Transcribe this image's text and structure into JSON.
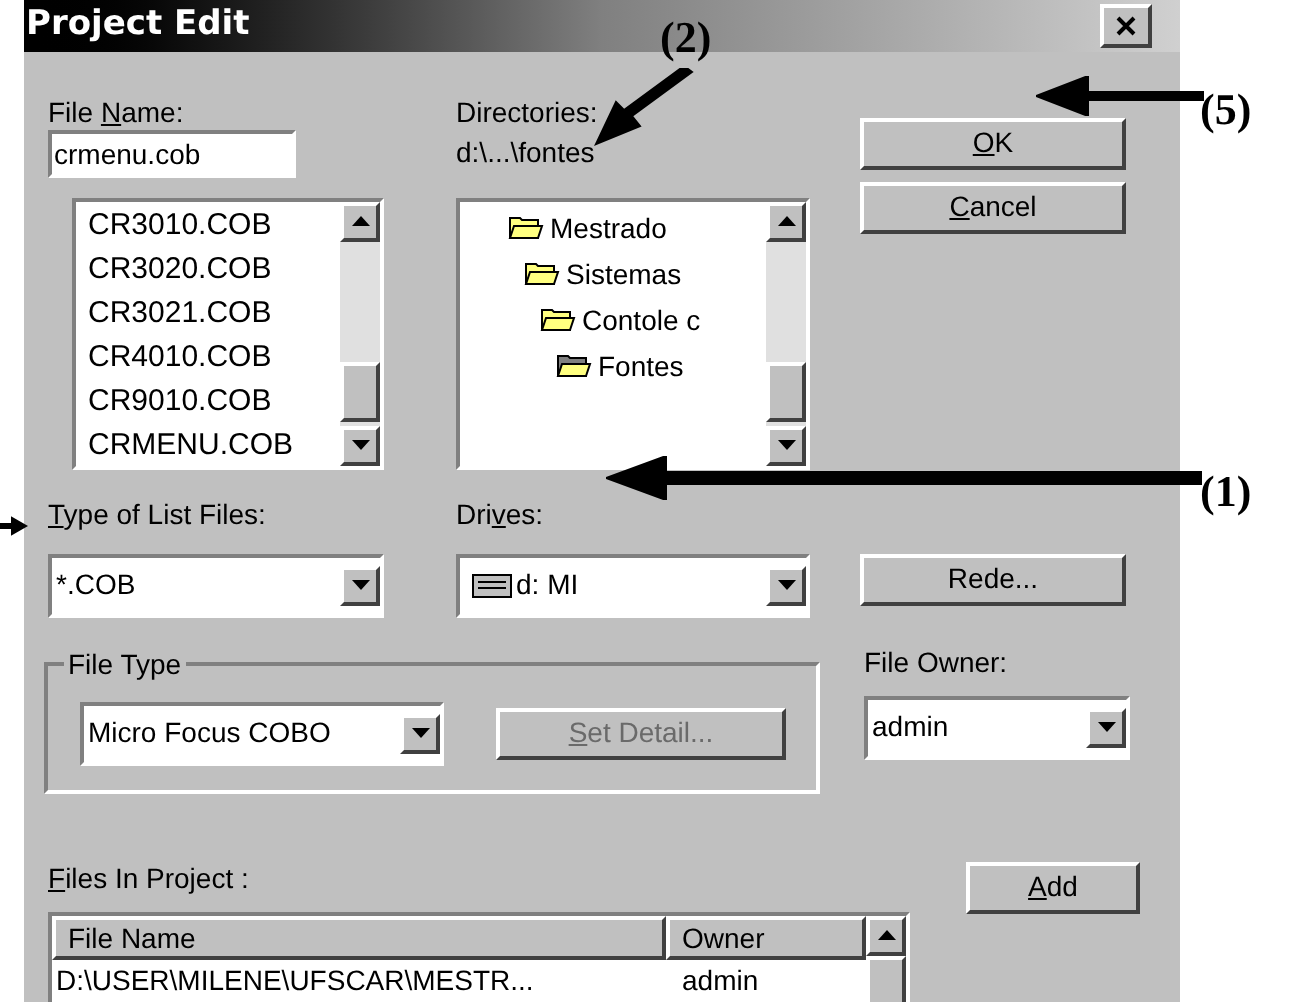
{
  "window": {
    "title": "Project Edit"
  },
  "file_name": {
    "label": {
      "pre": "File ",
      "key": "N",
      "post": "ame:"
    },
    "value": "crmenu.cob",
    "files": [
      {
        "name": "CR3010.COB"
      },
      {
        "name": "CR3020.COB"
      },
      {
        "name": "CR3021.COB"
      },
      {
        "name": "CR4010.COB"
      },
      {
        "name": "CR9010.COB"
      },
      {
        "name": "CRMENU.COB"
      }
    ]
  },
  "directories": {
    "label": "Directories:",
    "path": "d:\\...\\fontes",
    "folders": [
      {
        "name": "Mestrado",
        "current": false,
        "children": [
          {
            "name": "Sistemas",
            "current": false,
            "children": [
              {
                "name": "Contole c",
                "current": false,
                "children": [
                  {
                    "name": "Fontes",
                    "current": true
                  }
                ]
              }
            ]
          }
        ]
      }
    ]
  },
  "buttons": [
    {
      "key": "O",
      "post": "K"
    },
    {
      "key": "C",
      "post": "ancel"
    }
  ],
  "type_of_list_files": {
    "label": {
      "key": "T",
      "post": "ype of List Files:"
    },
    "value": "*.COB"
  },
  "drives": {
    "label": {
      "pre": "Dri",
      "key": "v",
      "post": "es:"
    },
    "value": "d: MI"
  },
  "rede_button": "Rede...",
  "file_type": {
    "legend": "File Type",
    "value": "Micro Focus COBO",
    "set_detail": {
      "key": "S",
      "post": "et Detail...",
      "disabled": true
    }
  },
  "file_owner": {
    "label": "File Owner:",
    "value": "admin"
  },
  "files_in_project": {
    "label": {
      "key": "F",
      "post": "iles In Project :"
    },
    "columns": [
      "File Name",
      "Owner"
    ],
    "rows": [
      [
        "D:\\USER\\MILENE\\UFSCAR\\MESTR...",
        "admin"
      ]
    ],
    "add_button": {
      "key": "A",
      "post": "dd"
    }
  },
  "annotations": [
    {
      "label": "(2)"
    },
    {
      "label": "(5)"
    },
    {
      "label": "(1)"
    }
  ]
}
